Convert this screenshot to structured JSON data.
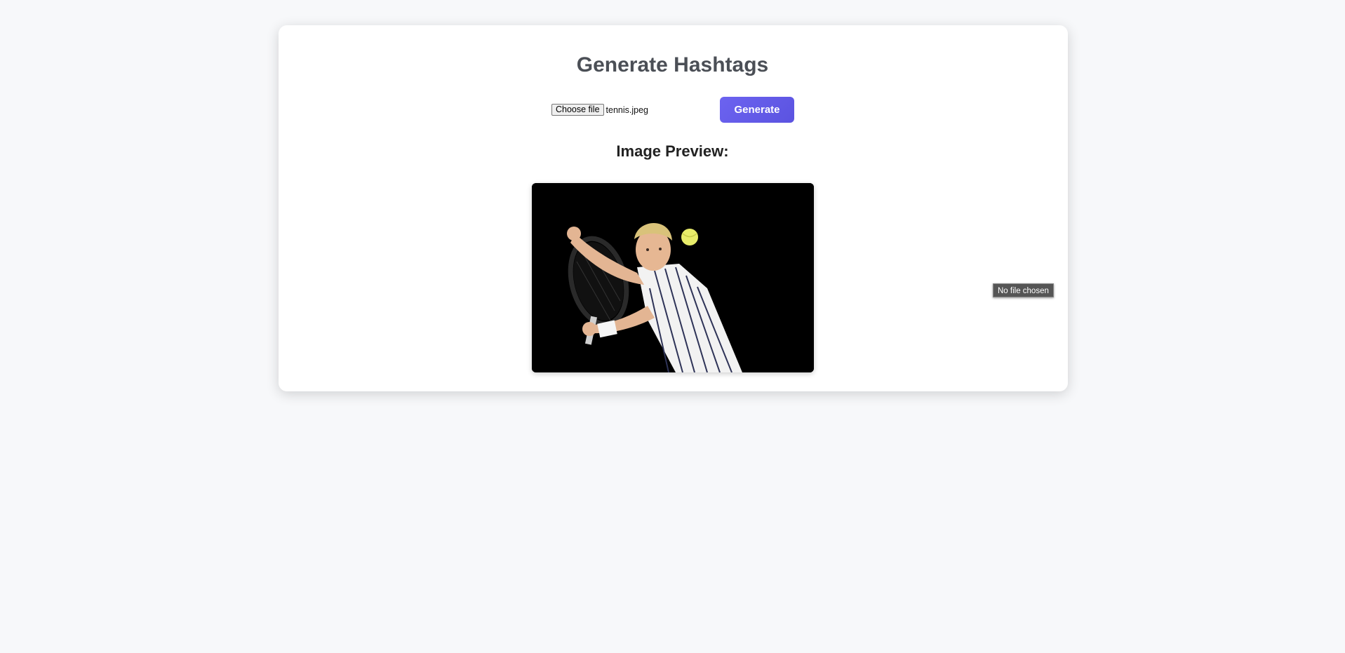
{
  "page": {
    "title": "Generate Hashtags",
    "preview_heading": "Image Preview:"
  },
  "upload": {
    "choose_label": "Choose file",
    "file_name": "tennis.jpeg",
    "generate_label": "Generate"
  },
  "tooltip": {
    "text": "No file chosen"
  },
  "preview": {
    "subject": "tennis player hitting backhand"
  },
  "colors": {
    "accent": "#6c63f0",
    "background": "#f7f8fa",
    "card": "#ffffff"
  }
}
